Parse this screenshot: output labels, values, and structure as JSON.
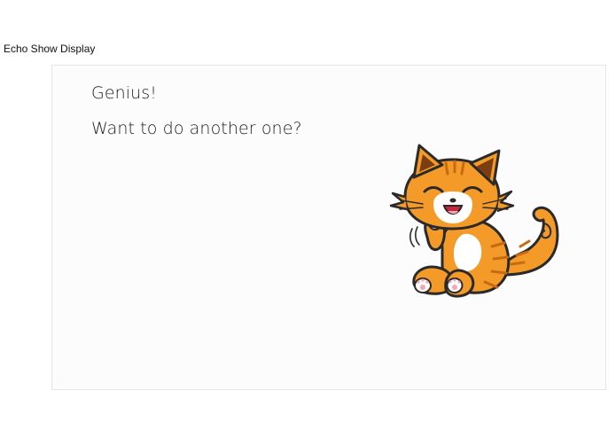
{
  "header": {
    "title": "Echo Show Display"
  },
  "display": {
    "lines": [
      "Genius!",
      "Want to do another one?"
    ]
  },
  "illustration": {
    "icon": "cat-illustration",
    "colors": {
      "fur": "#f49a28",
      "fur_light": "#fbc061",
      "outline": "#2a2a2a",
      "belly": "#ffffff",
      "paw_pad": "#f4a6b2"
    }
  }
}
